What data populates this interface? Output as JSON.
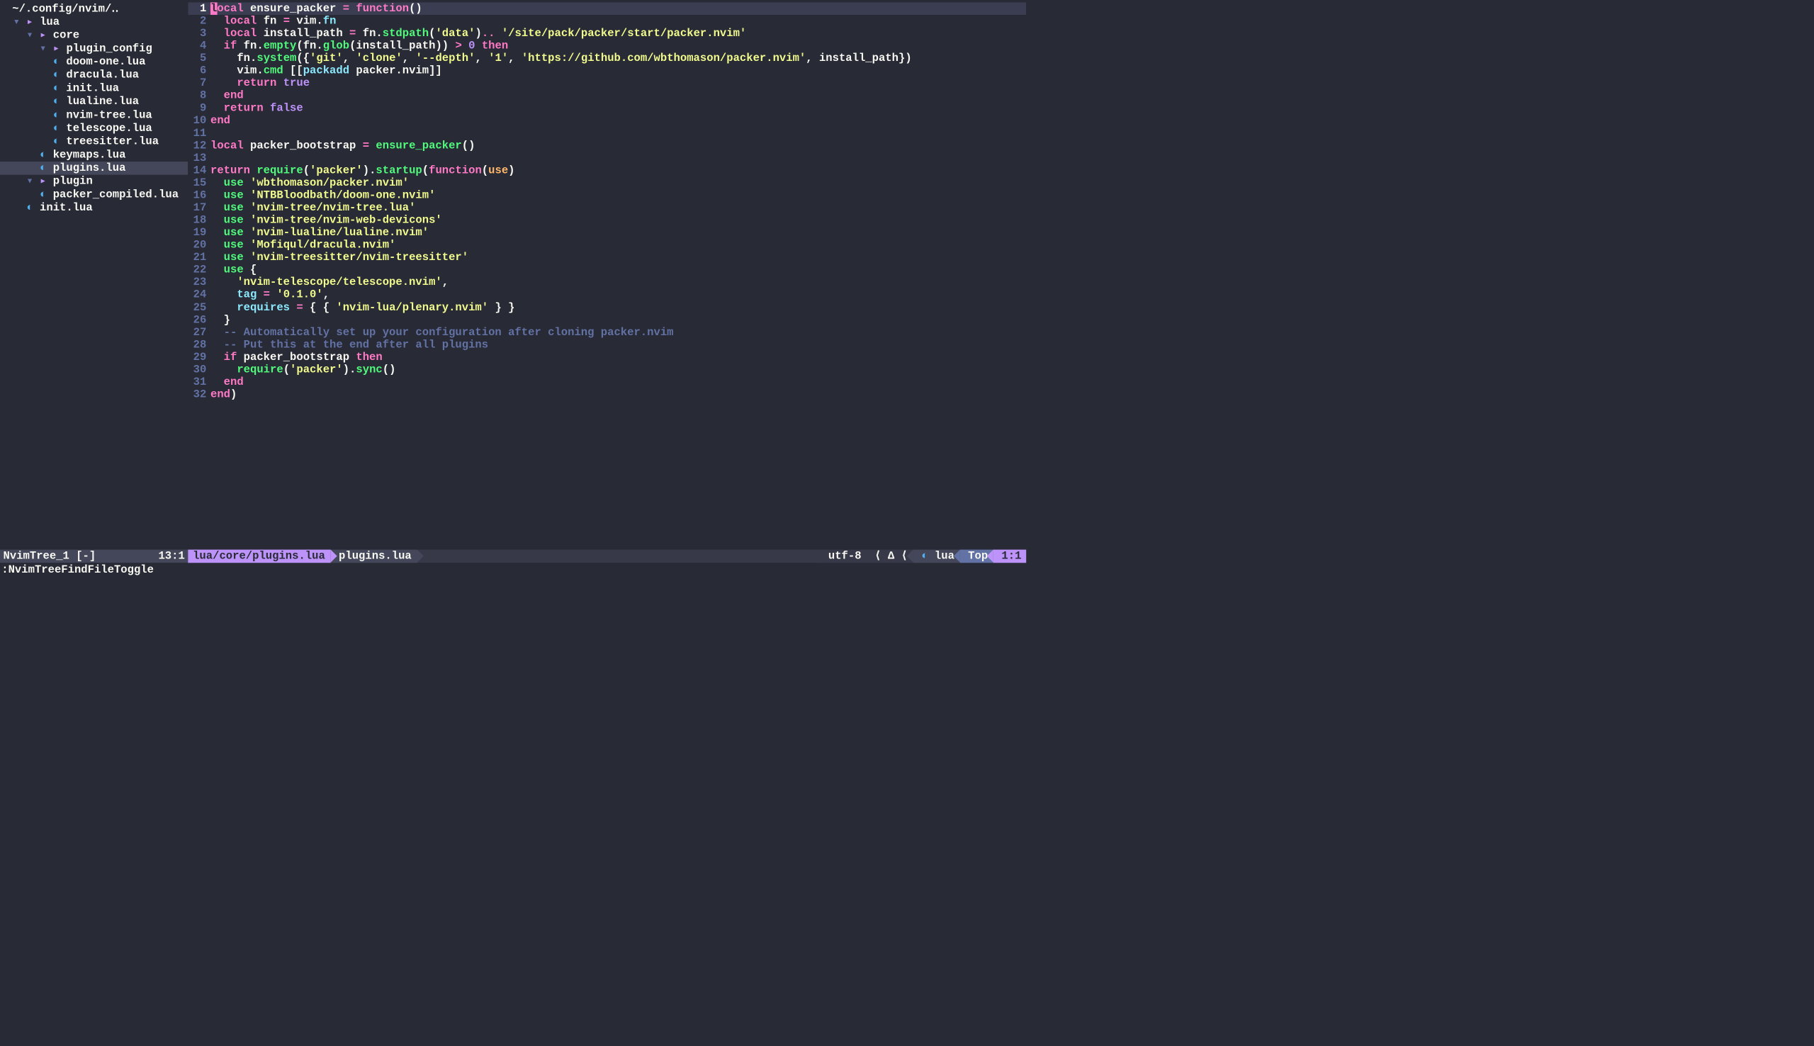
{
  "tree": {
    "header": "~/.config/nvim/‥",
    "rows": [
      {
        "indent": 1,
        "chev": "▾",
        "type": "folder",
        "label": "lua"
      },
      {
        "indent": 2,
        "chev": "▾",
        "type": "folder",
        "label": "core"
      },
      {
        "indent": 3,
        "chev": "▾",
        "type": "folder",
        "label": "plugin_config"
      },
      {
        "indent": 4,
        "type": "file",
        "label": "doom-one.lua"
      },
      {
        "indent": 4,
        "type": "file",
        "label": "dracula.lua"
      },
      {
        "indent": 4,
        "type": "file",
        "label": "init.lua"
      },
      {
        "indent": 4,
        "type": "file",
        "label": "lualine.lua"
      },
      {
        "indent": 4,
        "type": "file",
        "label": "nvim-tree.lua"
      },
      {
        "indent": 4,
        "type": "file",
        "label": "telescope.lua"
      },
      {
        "indent": 4,
        "type": "file",
        "label": "treesitter.lua"
      },
      {
        "indent": 3,
        "type": "file",
        "label": "keymaps.lua"
      },
      {
        "indent": 3,
        "type": "file",
        "label": "plugins.lua",
        "selected": true
      },
      {
        "indent": 2,
        "chev": "▾",
        "type": "folder",
        "label": "plugin"
      },
      {
        "indent": 3,
        "type": "file",
        "label": "packer_compiled.lua"
      },
      {
        "indent": 2,
        "type": "file",
        "label": "init.lua"
      }
    ]
  },
  "code": [
    {
      "n": 1,
      "cur": true,
      "t": [
        [
          "cursor",
          "l"
        ],
        [
          "kw",
          "ocal "
        ],
        [
          "ident",
          "ensure_packer "
        ],
        [
          "op",
          "= "
        ],
        [
          "kw",
          "function"
        ],
        [
          "punct",
          "()"
        ]
      ]
    },
    {
      "n": 2,
      "t": [
        [
          "ident",
          "  "
        ],
        [
          "kw",
          "local "
        ],
        [
          "ident",
          "fn "
        ],
        [
          "op",
          "= "
        ],
        [
          "ident",
          "vim"
        ],
        [
          "punct",
          "."
        ],
        [
          "teal",
          "fn"
        ]
      ]
    },
    {
      "n": 3,
      "t": [
        [
          "ident",
          "  "
        ],
        [
          "kw",
          "local "
        ],
        [
          "ident",
          "install_path "
        ],
        [
          "op",
          "= "
        ],
        [
          "ident",
          "fn"
        ],
        [
          "punct",
          "."
        ],
        [
          "call",
          "stdpath"
        ],
        [
          "punct",
          "("
        ],
        [
          "str",
          "'data'"
        ],
        [
          "punct",
          ")"
        ],
        [
          "op",
          ".. "
        ],
        [
          "str",
          "'/site/pack/packer/start/packer.nvim'"
        ]
      ]
    },
    {
      "n": 4,
      "t": [
        [
          "ident",
          "  "
        ],
        [
          "kw",
          "if "
        ],
        [
          "ident",
          "fn"
        ],
        [
          "punct",
          "."
        ],
        [
          "call",
          "empty"
        ],
        [
          "punct",
          "("
        ],
        [
          "ident",
          "fn"
        ],
        [
          "punct",
          "."
        ],
        [
          "call",
          "glob"
        ],
        [
          "punct",
          "("
        ],
        [
          "ident",
          "install_path"
        ],
        [
          "punct",
          "))"
        ],
        [
          "op",
          " > "
        ],
        [
          "num",
          "0 "
        ],
        [
          "kw",
          "then"
        ]
      ]
    },
    {
      "n": 5,
      "t": [
        [
          "ident",
          "    fn"
        ],
        [
          "punct",
          "."
        ],
        [
          "call",
          "system"
        ],
        [
          "punct",
          "({"
        ],
        [
          "str",
          "'git'"
        ],
        [
          "punct",
          ", "
        ],
        [
          "str",
          "'clone'"
        ],
        [
          "punct",
          ", "
        ],
        [
          "str",
          "'--depth'"
        ],
        [
          "punct",
          ", "
        ],
        [
          "str",
          "'1'"
        ],
        [
          "punct",
          ", "
        ],
        [
          "str",
          "'https://github.com/wbthomason/packer.nvim'"
        ],
        [
          "punct",
          ", "
        ],
        [
          "ident",
          "install_path"
        ],
        [
          "punct",
          "})"
        ]
      ]
    },
    {
      "n": 6,
      "t": [
        [
          "ident",
          "    vim"
        ],
        [
          "punct",
          "."
        ],
        [
          "call",
          "cmd "
        ],
        [
          "punct",
          "[["
        ],
        [
          "teal",
          "packadd "
        ],
        [
          "ident",
          "packer.nvim"
        ],
        [
          "punct",
          "]]"
        ]
      ]
    },
    {
      "n": 7,
      "t": [
        [
          "ident",
          "    "
        ],
        [
          "kw",
          "return "
        ],
        [
          "bool",
          "true"
        ]
      ]
    },
    {
      "n": 8,
      "t": [
        [
          "ident",
          "  "
        ],
        [
          "kw",
          "end"
        ]
      ]
    },
    {
      "n": 9,
      "t": [
        [
          "ident",
          "  "
        ],
        [
          "kw",
          "return "
        ],
        [
          "bool",
          "false"
        ]
      ]
    },
    {
      "n": 10,
      "t": [
        [
          "kw",
          "end"
        ]
      ]
    },
    {
      "n": 11,
      "t": []
    },
    {
      "n": 12,
      "t": [
        [
          "kw",
          "local "
        ],
        [
          "ident",
          "packer_bootstrap "
        ],
        [
          "op",
          "= "
        ],
        [
          "call",
          "ensure_packer"
        ],
        [
          "punct",
          "()"
        ]
      ]
    },
    {
      "n": 13,
      "t": []
    },
    {
      "n": 14,
      "t": [
        [
          "kw",
          "return "
        ],
        [
          "call",
          "require"
        ],
        [
          "punct",
          "("
        ],
        [
          "str",
          "'packer'"
        ],
        [
          "punct",
          ")."
        ],
        [
          "call",
          "startup"
        ],
        [
          "punct",
          "("
        ],
        [
          "kw",
          "function"
        ],
        [
          "punct",
          "("
        ],
        [
          "param",
          "use"
        ],
        [
          "punct",
          ")"
        ]
      ]
    },
    {
      "n": 15,
      "t": [
        [
          "ident",
          "  "
        ],
        [
          "call",
          "use "
        ],
        [
          "str",
          "'wbthomason/packer.nvim'"
        ]
      ]
    },
    {
      "n": 16,
      "t": [
        [
          "ident",
          "  "
        ],
        [
          "call",
          "use "
        ],
        [
          "str",
          "'NTBBloodbath/doom-one.nvim'"
        ]
      ]
    },
    {
      "n": 17,
      "t": [
        [
          "ident",
          "  "
        ],
        [
          "call",
          "use "
        ],
        [
          "str",
          "'nvim-tree/nvim-tree.lua'"
        ]
      ]
    },
    {
      "n": 18,
      "t": [
        [
          "ident",
          "  "
        ],
        [
          "call",
          "use "
        ],
        [
          "str",
          "'nvim-tree/nvim-web-devicons'"
        ]
      ]
    },
    {
      "n": 19,
      "t": [
        [
          "ident",
          "  "
        ],
        [
          "call",
          "use "
        ],
        [
          "str",
          "'nvim-lualine/lualine.nvim'"
        ]
      ]
    },
    {
      "n": 20,
      "t": [
        [
          "ident",
          "  "
        ],
        [
          "call",
          "use "
        ],
        [
          "str",
          "'Mofiqul/dracula.nvim'"
        ]
      ]
    },
    {
      "n": 21,
      "t": [
        [
          "ident",
          "  "
        ],
        [
          "call",
          "use "
        ],
        [
          "str",
          "'nvim-treesitter/nvim-treesitter'"
        ]
      ]
    },
    {
      "n": 22,
      "t": [
        [
          "ident",
          "  "
        ],
        [
          "call",
          "use "
        ],
        [
          "punct",
          "{"
        ]
      ]
    },
    {
      "n": 23,
      "t": [
        [
          "ident",
          "    "
        ],
        [
          "str",
          "'nvim-telescope/telescope.nvim'"
        ],
        [
          "punct",
          ","
        ]
      ]
    },
    {
      "n": 24,
      "t": [
        [
          "ident",
          "    "
        ],
        [
          "teal",
          "tag "
        ],
        [
          "op",
          "= "
        ],
        [
          "str",
          "'0.1.0'"
        ],
        [
          "punct",
          ","
        ]
      ]
    },
    {
      "n": 25,
      "t": [
        [
          "ident",
          "    "
        ],
        [
          "teal",
          "requires "
        ],
        [
          "op",
          "= "
        ],
        [
          "punct",
          "{ { "
        ],
        [
          "str",
          "'nvim-lua/plenary.nvim'"
        ],
        [
          "punct",
          " } }"
        ]
      ]
    },
    {
      "n": 26,
      "t": [
        [
          "ident",
          "  "
        ],
        [
          "punct",
          "}"
        ]
      ]
    },
    {
      "n": 27,
      "t": [
        [
          "ident",
          "  "
        ],
        [
          "comment",
          "-- Automatically set up your configuration after cloning packer.nvim"
        ]
      ]
    },
    {
      "n": 28,
      "t": [
        [
          "ident",
          "  "
        ],
        [
          "comment",
          "-- Put this at the end after all plugins"
        ]
      ]
    },
    {
      "n": 29,
      "t": [
        [
          "ident",
          "  "
        ],
        [
          "kw",
          "if "
        ],
        [
          "ident",
          "packer_bootstrap "
        ],
        [
          "kw",
          "then"
        ]
      ]
    },
    {
      "n": 30,
      "t": [
        [
          "ident",
          "    "
        ],
        [
          "call",
          "require"
        ],
        [
          "punct",
          "("
        ],
        [
          "str",
          "'packer'"
        ],
        [
          "punct",
          ")."
        ],
        [
          "call",
          "sync"
        ],
        [
          "punct",
          "()"
        ]
      ]
    },
    {
      "n": 31,
      "t": [
        [
          "ident",
          "  "
        ],
        [
          "kw",
          "end"
        ]
      ]
    },
    {
      "n": 32,
      "t": [
        [
          "kw",
          "end"
        ],
        [
          "punct",
          ")"
        ]
      ]
    }
  ],
  "status": {
    "left": {
      "name": "NvimTree_1 [-]",
      "pos": "13:1"
    },
    "bc1": "lua/core/plugins.lua",
    "bc2": "plugins.lua",
    "enc": "utf-8",
    "ff": "",
    "lang": "lua",
    "top": "Top",
    "pos": "1:1"
  },
  "cmd": ":NvimTreeFindFileToggle"
}
